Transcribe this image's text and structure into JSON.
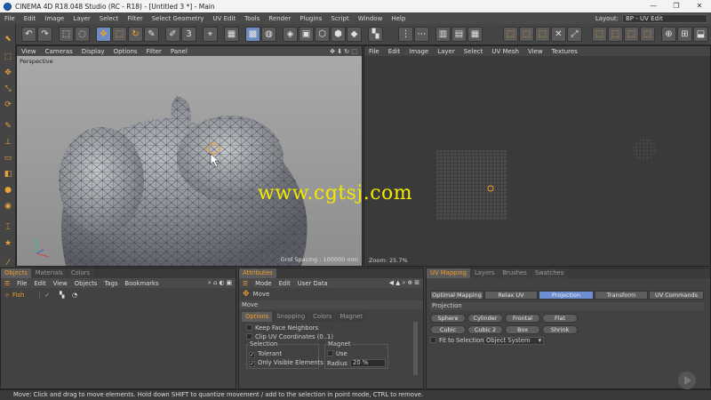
{
  "window": {
    "title": "CINEMA 4D R18.048 Studio (RC - R18) - [Untitled 3 *] - Main",
    "minimize": "—",
    "restore": "❐",
    "close": "✕"
  },
  "menu": [
    "File",
    "Edit",
    "Image",
    "Layer",
    "Select",
    "Filter",
    "Select Geometry",
    "UV Edit",
    "Tools",
    "Render",
    "Plugins",
    "Script",
    "Window",
    "Help"
  ],
  "layout": {
    "label": "Layout:",
    "value": "BP - UV Edit"
  },
  "viewport": {
    "menu": [
      "View",
      "Cameras",
      "Display",
      "Options",
      "Filter",
      "Panel"
    ],
    "camera": "Perspective",
    "grid_spacing": "Grid Spacing : 100000 mm"
  },
  "uv_editor": {
    "menu": [
      "File",
      "Edit",
      "Image",
      "Layer",
      "Select",
      "UV Mesh",
      "View",
      "Textures"
    ],
    "zoom": "Zoom: 25.7%"
  },
  "objects_panel": {
    "tabs": [
      "Objects",
      "Materials",
      "Colors"
    ],
    "menu": [
      "File",
      "Edit",
      "View",
      "Objects",
      "Tags",
      "Bookmarks"
    ],
    "item": "Fish"
  },
  "attributes": {
    "tabs": [
      "Attributes"
    ],
    "menu": [
      "Mode",
      "Edit",
      "User Data"
    ],
    "tool": "Move",
    "section": "Move",
    "subtabs": [
      "Options",
      "Snapping",
      "Colors",
      "Magnet"
    ],
    "keep_face": "Keep Face Neighbors",
    "clip_uv": "Clip UV Coordinates (0..1)",
    "selection_label": "Selection",
    "tolerant": "Tolerant",
    "only_visible": "Only Visible Elements",
    "magnet_label": "Magnet",
    "use": "Use",
    "radius_label": "Radius",
    "radius_value": "20 %"
  },
  "uv_mapping": {
    "tabs": [
      "UV Mapping",
      "Layers",
      "Brushes",
      "Swatches"
    ],
    "modes": [
      "Optimal Mapping",
      "Relax UV",
      "Projection",
      "Transform",
      "UV Commands"
    ],
    "projection_label": "Projection",
    "buttons": [
      "Sphere",
      "Cylinder",
      "Frontal",
      "Flat",
      "Cubic",
      "Cubic 2",
      "Box",
      "Shrink"
    ],
    "fit_label": "Fit to Selection",
    "fit_value": "Object System"
  },
  "status": "Move: Click and drag to move elements. Hold down SHIFT to quantize movement / add to the selection in point mode, CTRL to remove.",
  "watermark": "www.cgtsj.com",
  "colors": {
    "accent": "#f39c2a",
    "selected_button": "#6d8fd2",
    "watermark": "#f5e800"
  }
}
